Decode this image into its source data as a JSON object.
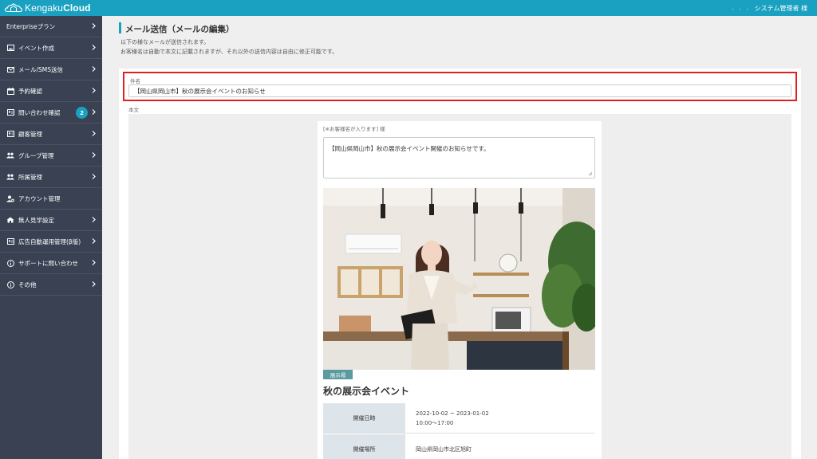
{
  "app": {
    "logo_word1": "Kengaku",
    "logo_word2": "Cloud",
    "user_dots": ". . .",
    "user_label": "システム管理者 様"
  },
  "colors": {
    "topbar": "#1aa1c1",
    "sidebar": "#394152",
    "highlight_border": "#e02020",
    "tag": "#5b9aa0"
  },
  "sidebar": {
    "items": [
      {
        "label": "Enterpriseプラン",
        "icon": "none"
      },
      {
        "label": "イベント作成",
        "icon": "image-icon"
      },
      {
        "label": "メール/SMS送信",
        "icon": "envelope-icon"
      },
      {
        "label": "予約確認",
        "icon": "calendar-icon"
      },
      {
        "label": "問い合わせ確認",
        "icon": "id-card-icon",
        "badge": "2"
      },
      {
        "label": "顧客管理",
        "icon": "address-card-icon"
      },
      {
        "label": "グループ管理",
        "icon": "users-icon"
      },
      {
        "label": "所属管理",
        "icon": "users-icon"
      },
      {
        "label": "アカウント管理",
        "icon": "user-gear-icon"
      },
      {
        "label": "無人見学設定",
        "icon": "home-icon"
      },
      {
        "label": "広告自動運用管理(β版)",
        "icon": "id-card-icon"
      },
      {
        "label": "サポートに問い合わせ",
        "icon": "info-icon"
      },
      {
        "label": "その他",
        "icon": "info-icon"
      }
    ]
  },
  "main": {
    "title": "メール送信（メールの編集）",
    "desc1": "以下の様なメールが送信されます。",
    "desc2": "お客様名は自動で本文に記載されますが、それ以外の送信内容は自由に修正可能です。",
    "subject_label": "件名",
    "subject_value": "【岡山県岡山市】秋の展示会イベントのお知らせ",
    "body_label": "本文",
    "greeting": "[※お客様名が入ります] 様",
    "message": "【岡山県岡山市】秋の展示会イベント開催のお知らせです。",
    "tag": "展示場",
    "event_title": "秋の展示会イベント",
    "info": [
      {
        "head": "開催日時",
        "line1": "2022-10-02 ~ 2023-01-02",
        "line2": "10:00〜17:00"
      },
      {
        "head": "開催場所",
        "line1": "岡山県岡山市北区旭町",
        "line2": ""
      }
    ]
  }
}
